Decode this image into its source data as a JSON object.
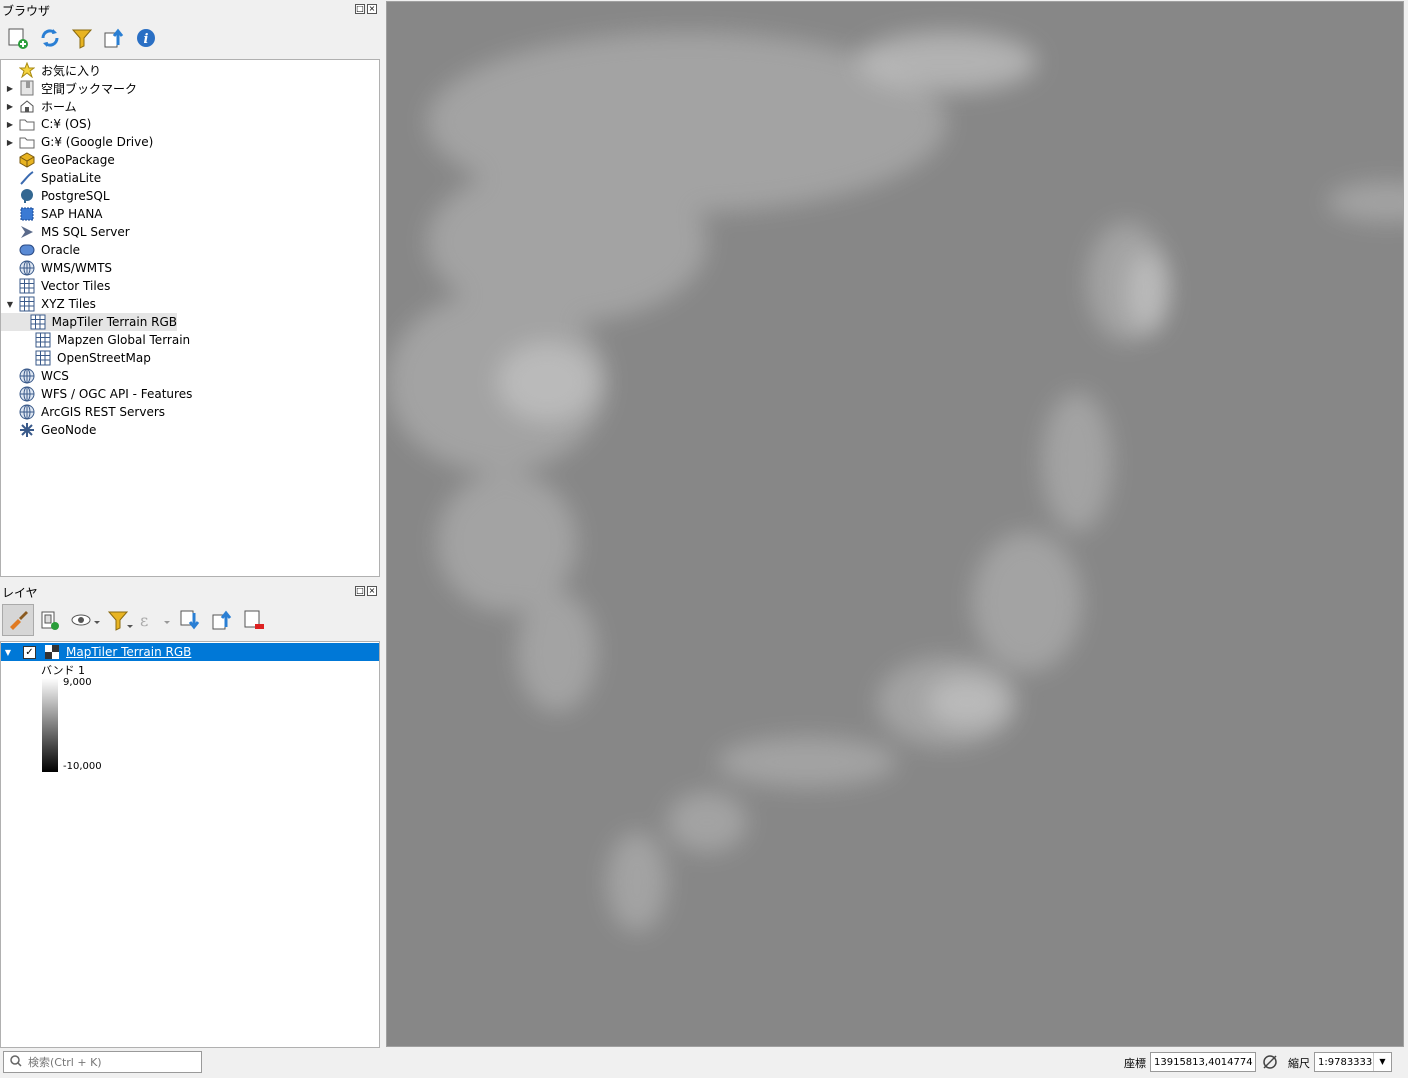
{
  "browser": {
    "title": "ブラウザ",
    "toolbar": [
      "add-layer",
      "refresh",
      "filter",
      "collapse-all",
      "properties"
    ],
    "items": [
      {
        "label": "お気に入り",
        "icon": "star-icon",
        "arrow": "",
        "indent": 0
      },
      {
        "label": "空間ブックマーク",
        "icon": "bookmark-icon",
        "arrow": "▶",
        "indent": 0
      },
      {
        "label": "ホーム",
        "icon": "home-icon",
        "arrow": "▶",
        "indent": 0
      },
      {
        "label": "C:¥ (OS)",
        "icon": "folder-icon",
        "arrow": "▶",
        "indent": 0
      },
      {
        "label": "G:¥ (Google Drive)",
        "icon": "folder-icon",
        "arrow": "▶",
        "indent": 0
      },
      {
        "label": "GeoPackage",
        "icon": "geopackage-icon",
        "arrow": "",
        "indent": 0
      },
      {
        "label": "SpatiaLite",
        "icon": "spatialite-icon",
        "arrow": "",
        "indent": 0
      },
      {
        "label": "PostgreSQL",
        "icon": "postgresql-icon",
        "arrow": "",
        "indent": 0
      },
      {
        "label": "SAP HANA",
        "icon": "sap-hana-icon",
        "arrow": "",
        "indent": 0
      },
      {
        "label": "MS SQL Server",
        "icon": "mssql-icon",
        "arrow": "",
        "indent": 0
      },
      {
        "label": "Oracle",
        "icon": "oracle-icon",
        "arrow": "",
        "indent": 0
      },
      {
        "label": "WMS/WMTS",
        "icon": "globe-icon",
        "arrow": "",
        "indent": 0
      },
      {
        "label": "Vector Tiles",
        "icon": "grid-icon",
        "arrow": "",
        "indent": 0
      },
      {
        "label": "XYZ Tiles",
        "icon": "grid-icon",
        "arrow": "▼",
        "indent": 0
      },
      {
        "label": "MapTiler Terrain RGB",
        "icon": "grid-icon",
        "arrow": "",
        "indent": 1,
        "selected": true
      },
      {
        "label": "Mapzen Global Terrain",
        "icon": "grid-icon",
        "arrow": "",
        "indent": 1
      },
      {
        "label": "OpenStreetMap",
        "icon": "grid-icon",
        "arrow": "",
        "indent": 1
      },
      {
        "label": "WCS",
        "icon": "globe-icon",
        "arrow": "",
        "indent": 0
      },
      {
        "label": "WFS / OGC API - Features",
        "icon": "globe-icon",
        "arrow": "",
        "indent": 0
      },
      {
        "label": "ArcGIS REST Servers",
        "icon": "globe-icon",
        "arrow": "",
        "indent": 0
      },
      {
        "label": "GeoNode",
        "icon": "geonode-icon",
        "arrow": "",
        "indent": 0
      }
    ]
  },
  "layers": {
    "title": "レイヤ",
    "layer_name": "MapTiler Terrain RGB",
    "checked": true,
    "band_label": "バンド 1",
    "legend_max": "9,000",
    "legend_min": "-10,000",
    "accent": "#0078d7"
  },
  "status": {
    "search_placeholder": "検索(Ctrl + K)",
    "coord_label": "座標",
    "coord_value": "13915813,4014774",
    "scale_label": "縮尺",
    "scale_value": "1:9783333"
  }
}
